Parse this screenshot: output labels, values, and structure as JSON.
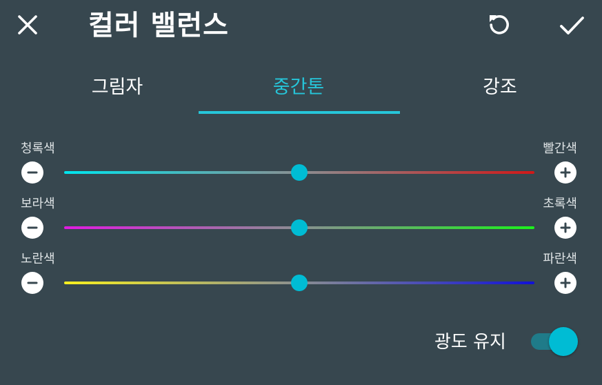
{
  "toolbar": {
    "title": "컬러 밸런스",
    "close_icon": "close-icon",
    "reset_icon": "reset-icon",
    "apply_icon": "check-icon"
  },
  "tabs": [
    {
      "label": "그림자",
      "active": false
    },
    {
      "label": "중간톤",
      "active": true
    },
    {
      "label": "강조",
      "active": false
    }
  ],
  "sliders": [
    {
      "left_label": "청록색",
      "right_label": "빨간색",
      "left_color": "#00e5ee",
      "right_color": "#d01818",
      "value": 0.5
    },
    {
      "left_label": "보라색",
      "right_label": "초록색",
      "left_color": "#e01ce0",
      "right_color": "#1cf01c",
      "value": 0.5
    },
    {
      "left_label": "노란색",
      "right_label": "파란색",
      "left_color": "#f8f020",
      "right_color": "#1010d8",
      "value": 0.5
    }
  ],
  "luminosity": {
    "label": "광도 유지",
    "enabled": true
  },
  "colors": {
    "accent": "#26c6da",
    "thumb": "#00bcd4",
    "background": "#37474f"
  }
}
